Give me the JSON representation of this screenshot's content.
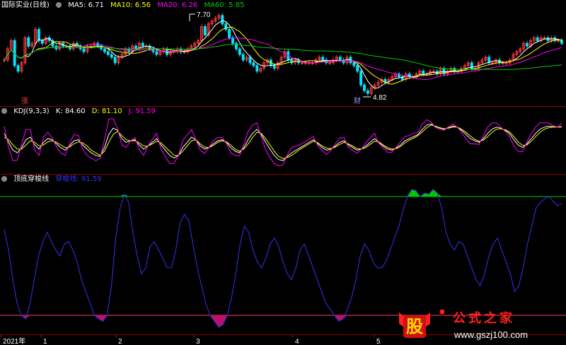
{
  "panel1": {
    "title": "国际实业(日线)",
    "ma5": "MA5: 6.71",
    "ma10": "MA10: 6.56",
    "ma20": "MA20: 6.26",
    "ma60": "MA60: 5.85",
    "high_label": "7.70",
    "low_label": "4.82",
    "badge_zhang": "涨",
    "badge_cai": "财"
  },
  "panel2": {
    "title": "KDJ(9,3,3)",
    "k": "K: 84.60",
    "d": "D: 81.10",
    "j": "J: 91.59"
  },
  "panel3": {
    "title": "顶底穿梭线",
    "value": "穿梭线: 91.59"
  },
  "xaxis": {
    "labels": [
      "2021年",
      "1",
      "2",
      "3",
      "4",
      "5"
    ]
  },
  "watermark": {
    "glyph": "股",
    "text": "公式之家",
    "url": "www.gszj100.com"
  },
  "colors": {
    "up": "#ff3b3b",
    "down": "#00e5ff",
    "ma5": "#ffffff",
    "ma10": "#ffff00",
    "ma20": "#ff00ff",
    "ma60": "#00cc00",
    "k": "#ffffff",
    "d": "#ffff00",
    "j": "#ff00ff",
    "shuttle": "#2b2bc8",
    "top_line": "#00cc00",
    "bottom_line": "#ff3b6b",
    "grid": "#8b0000"
  },
  "chart_data": [
    {
      "type": "candlestick",
      "title": "国际实业(日线)",
      "note": "approximate daily prices, high 7.70, low 4.82",
      "close": [
        6.1,
        6.5,
        6.8,
        5.9,
        5.7,
        6.0,
        6.9,
        6.6,
        6.7,
        7.2,
        6.8,
        6.7,
        6.9,
        6.8,
        6.6,
        6.5,
        6.7,
        6.6,
        6.6,
        6.5,
        6.7,
        6.6,
        6.5,
        6.4,
        6.6,
        6.6,
        6.7,
        6.6,
        6.5,
        6.4,
        6.3,
        6.2,
        6.0,
        6.2,
        6.3,
        6.5,
        6.4,
        6.6,
        6.5,
        6.7,
        6.6,
        6.6,
        6.5,
        6.4,
        6.3,
        6.4,
        6.5,
        6.3,
        6.4,
        6.4,
        6.5,
        6.4,
        6.4,
        6.5,
        6.6,
        6.7,
        6.8,
        7.3,
        7.0,
        7.4,
        7.5,
        7.6,
        7.7,
        7.4,
        7.2,
        6.9,
        6.7,
        6.5,
        6.3,
        6.1,
        6.2,
        6.0,
        5.9,
        5.7,
        5.8,
        6.0,
        6.1,
        5.9,
        5.8,
        6.0,
        6.2,
        6.4,
        6.1,
        6.0,
        6.1,
        6.0,
        6.0,
        6.0,
        6.0,
        6.0,
        6.1,
        6.2,
        6.1,
        6.0,
        6.0,
        6.1,
        6.2,
        6.1,
        6.0,
        6.2,
        6.0,
        5.9,
        5.7,
        5.2,
        5.0,
        4.9,
        5.1,
        5.2,
        5.3,
        5.4,
        5.3,
        5.4,
        5.5,
        5.6,
        5.5,
        5.4,
        5.6,
        5.5,
        5.5,
        5.6,
        5.7,
        5.6,
        5.6,
        5.7,
        5.7,
        5.6,
        5.8,
        5.6,
        5.7,
        5.8,
        5.7,
        5.7,
        5.8,
        5.9,
        6.0,
        5.8,
        5.8,
        6.0,
        6.1,
        6.2,
        6.0,
        6.0,
        6.1,
        6.0,
        6.0,
        6.0,
        6.1,
        6.3,
        6.4,
        6.5,
        6.7,
        6.6,
        6.8,
        6.9,
        6.8,
        6.9,
        6.9,
        6.8,
        6.9,
        6.8,
        6.8,
        6.7
      ],
      "ma5_last": 6.71,
      "ma10_last": 6.56,
      "ma20_last": 6.26,
      "ma60_last": 5.85,
      "high_marker": 7.7,
      "low_marker": 4.82
    },
    {
      "type": "line",
      "title": "KDJ(9,3,3)",
      "ylim": [
        0,
        100
      ],
      "series": [
        {
          "name": "K",
          "values": [
            72,
            55,
            40,
            35,
            45,
            60,
            65,
            50,
            42,
            55,
            62,
            60,
            52,
            45,
            40,
            48,
            58,
            60,
            50,
            42,
            35,
            30,
            28,
            45,
            70,
            82,
            78,
            62,
            55,
            58,
            60,
            50,
            42,
            48,
            55,
            62,
            50,
            40,
            30,
            25,
            30,
            45,
            55,
            65,
            60,
            48,
            42,
            45,
            52,
            58,
            60,
            55,
            45,
            38,
            35,
            45,
            60,
            72,
            80,
            70,
            55,
            42,
            30,
            22,
            20,
            28,
            35,
            40,
            45,
            50,
            55,
            60,
            52,
            45,
            40,
            42,
            48,
            55,
            58,
            50,
            45,
            40,
            42,
            48,
            55,
            62,
            55,
            48,
            42,
            40,
            44,
            50,
            58,
            62,
            66,
            70,
            80,
            88,
            90,
            85,
            82,
            80,
            83,
            86,
            84,
            78,
            70,
            62,
            58,
            55,
            62,
            72,
            80,
            84,
            82,
            78,
            72,
            60,
            50,
            45,
            52,
            62,
            72,
            80,
            84,
            86,
            85,
            84,
            85
          ]
        },
        {
          "name": "D",
          "values": [
            65,
            60,
            50,
            42,
            42,
            50,
            58,
            55,
            48,
            50,
            56,
            58,
            55,
            50,
            45,
            46,
            52,
            56,
            54,
            48,
            40,
            35,
            30,
            38,
            55,
            70,
            76,
            68,
            60,
            58,
            58,
            54,
            48,
            48,
            52,
            57,
            54,
            46,
            38,
            30,
            30,
            38,
            48,
            58,
            60,
            52,
            46,
            45,
            49,
            55,
            58,
            56,
            50,
            42,
            38,
            42,
            52,
            64,
            74,
            72,
            62,
            50,
            38,
            28,
            24,
            26,
            30,
            36,
            42,
            47,
            52,
            57,
            54,
            48,
            44,
            43,
            46,
            51,
            55,
            52,
            48,
            43,
            42,
            45,
            51,
            57,
            56,
            50,
            45,
            42,
            43,
            47,
            54,
            59,
            63,
            68,
            75,
            83,
            88,
            86,
            83,
            81,
            82,
            84,
            84,
            80,
            74,
            67,
            61,
            57,
            59,
            66,
            74,
            80,
            81,
            79,
            75,
            66,
            56,
            49,
            50,
            57,
            66,
            74,
            80,
            83,
            84,
            84,
            84
          ]
        },
        {
          "name": "J",
          "values": [
            86,
            45,
            20,
            21,
            51,
            80,
            79,
            40,
            30,
            65,
            74,
            64,
            46,
            35,
            30,
            52,
            70,
            68,
            42,
            30,
            25,
            20,
            24,
            59,
            100,
            100,
            82,
            50,
            45,
            58,
            64,
            42,
            30,
            48,
            61,
            72,
            42,
            28,
            14,
            15,
            30,
            59,
            69,
            79,
            60,
            40,
            34,
            45,
            58,
            64,
            64,
            53,
            35,
            30,
            29,
            51,
            76,
            88,
            92,
            66,
            41,
            26,
            14,
            10,
            12,
            32,
            45,
            48,
            51,
            56,
            61,
            66,
            48,
            39,
            32,
            40,
            52,
            63,
            64,
            46,
            39,
            34,
            42,
            54,
            63,
            72,
            53,
            44,
            36,
            36,
            46,
            56,
            66,
            68,
            72,
            74,
            90,
            98,
            94,
            83,
            80,
            78,
            85,
            90,
            84,
            74,
            62,
            52,
            52,
            51,
            68,
            84,
            92,
            92,
            84,
            76,
            66,
            48,
            38,
            37,
            56,
            72,
            84,
            92,
            92,
            92,
            87,
            84,
            91.59
          ]
        }
      ]
    },
    {
      "type": "line",
      "title": "顶底穿梭线",
      "ylim": [
        0,
        100
      ],
      "top_threshold": 100,
      "bottom_threshold": 0,
      "series": [
        {
          "name": "穿梭线",
          "values": [
            72,
            55,
            30,
            10,
            0,
            -3,
            10,
            30,
            50,
            62,
            70,
            62,
            55,
            50,
            60,
            62,
            55,
            45,
            30,
            20,
            10,
            0,
            -3,
            -5,
            0,
            25,
            65,
            90,
            102,
            95,
            70,
            50,
            35,
            40,
            58,
            62,
            55,
            48,
            40,
            40,
            55,
            78,
            85,
            80,
            60,
            40,
            25,
            10,
            0,
            -5,
            -10,
            -8,
            0,
            15,
            35,
            60,
            75,
            70,
            55,
            45,
            40,
            48,
            60,
            65,
            58,
            45,
            35,
            30,
            40,
            55,
            60,
            50,
            40,
            30,
            20,
            10,
            5,
            0,
            -5,
            -3,
            5,
            15,
            30,
            50,
            60,
            55,
            45,
            40,
            40,
            45,
            55,
            65,
            75,
            88,
            100,
            106,
            105,
            100,
            103,
            102,
            106,
            103,
            90,
            70,
            60,
            55,
            62,
            60,
            50,
            40,
            30,
            25,
            35,
            50,
            60,
            65,
            55,
            45,
            35,
            20,
            25,
            40,
            60,
            75,
            90,
            95,
            98,
            100,
            96,
            92,
            94
          ]
        }
      ]
    }
  ]
}
